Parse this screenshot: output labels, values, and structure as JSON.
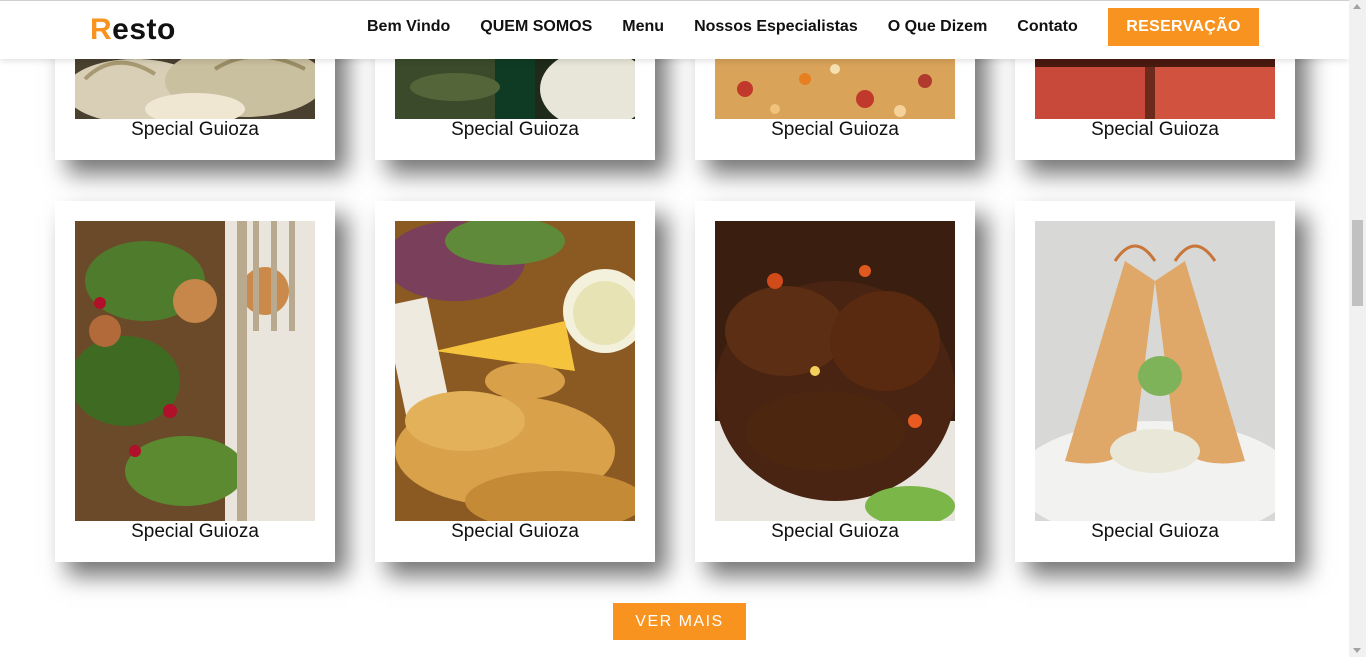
{
  "brand": {
    "first_letter": "R",
    "rest": "esto",
    "accent_color": "#f7931e"
  },
  "nav": {
    "links": [
      "Bem Vindo",
      "QUEM SOMOS",
      "Menu",
      "Nossos Especialistas",
      "O Que Dizem",
      "Contato"
    ],
    "cta": "RESERVAÇÃO"
  },
  "menu": {
    "row1": [
      {
        "caption": "Special Guioza",
        "image": "dumplings-photo"
      },
      {
        "caption": "Special Guioza",
        "image": "green-dish-photo"
      },
      {
        "caption": "Special Guioza",
        "image": "pizza-photo"
      },
      {
        "caption": "Special Guioza",
        "image": "seared-tuna-photo"
      }
    ],
    "row2": [
      {
        "caption": "Special Guioza",
        "image": "salad-photo"
      },
      {
        "caption": "Special Guioza",
        "image": "fried-fish-photo"
      },
      {
        "caption": "Special Guioza",
        "image": "grilled-meat-photo"
      },
      {
        "caption": "Special Guioza",
        "image": "shrimp-photo"
      }
    ],
    "more_button": "VER MAIS"
  }
}
